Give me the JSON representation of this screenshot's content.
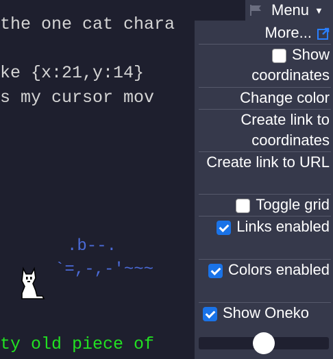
{
  "canvas": {
    "line1": "the one cat chara",
    "line2": "ke {x:21,y:14} ",
    "line3": "s my cursor mov",
    "ascii1": ".b--.",
    "ascii2": "`=,-,-'~~~",
    "line4": "ty old piece of"
  },
  "menu": {
    "button_label": "Menu",
    "items": {
      "more": "More...",
      "show_coordinates": "Show coordinates",
      "change_color": "Change color",
      "link_coordinates": "Create link to coordinates",
      "link_url": "Create link to URL",
      "toggle_grid": "Toggle grid",
      "links_enabled": "Links enabled",
      "colors_enabled": "Colors enabled",
      "show_oneko": "Show Oneko"
    },
    "checked": {
      "show_coordinates": false,
      "toggle_grid": false,
      "links_enabled": true,
      "colors_enabled": true,
      "show_oneko": true
    },
    "slider_value": 0.5
  },
  "colors": {
    "background": "#1e1f2e",
    "menu_bg": "#36394b",
    "accent": "#1a73e8",
    "ascii": "#4b6bd8",
    "green_text": "#22e022"
  },
  "icons": [
    "flag-icon",
    "caret-down-icon",
    "external-link-icon",
    "cat-sprite"
  ]
}
